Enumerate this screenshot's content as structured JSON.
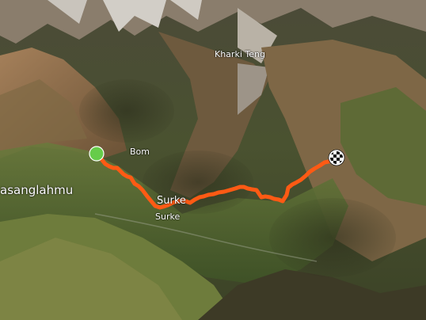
{
  "map": {
    "labels": {
      "kharki_teng": "Kharki Teng",
      "bom": "Bom",
      "surke_upper": "Surke",
      "surke_lower": "Surke",
      "sanglahmu": "asanglahmu"
    },
    "route": {
      "color": "#ff5a14",
      "start_marker_color": "#66cc4a",
      "end_marker_icon": "checkered-flag-icon"
    }
  }
}
